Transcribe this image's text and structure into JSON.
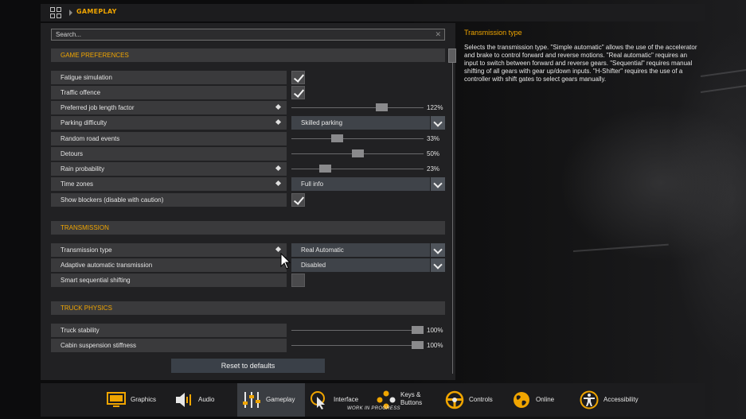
{
  "breadcrumb": {
    "label": "GAMEPLAY"
  },
  "search": {
    "placeholder": "Search..."
  },
  "sections": {
    "game_preferences": "GAME PREFERENCES",
    "transmission": "TRANSMISSION",
    "truck_physics": "TRUCK PHYSICS"
  },
  "rows": {
    "fatigue": {
      "label": "Fatigue simulation",
      "checked": true
    },
    "traffic": {
      "label": "Traffic offence",
      "checked": true
    },
    "job_length": {
      "label": "Preferred job length factor",
      "value": "122%",
      "level": 0.7
    },
    "parking": {
      "label": "Parking difficulty",
      "value": "Skilled parking"
    },
    "road_events": {
      "label": "Random road events",
      "value": "33%",
      "level": 0.33
    },
    "detours": {
      "label": "Detours",
      "value": "50%",
      "level": 0.5
    },
    "rain": {
      "label": "Rain probability",
      "value": "23%",
      "level": 0.23
    },
    "time_zones": {
      "label": "Time zones",
      "value": "Full info"
    },
    "blockers": {
      "label": "Show blockers (disable with caution)",
      "checked": true
    },
    "transmission_type": {
      "label": "Transmission type",
      "value": "Real Automatic"
    },
    "adaptive": {
      "label": "Adaptive automatic transmission",
      "value": "Disabled"
    },
    "smart_seq": {
      "label": "Smart sequential shifting",
      "checked": false
    },
    "stability": {
      "label": "Truck stability",
      "value": "100%",
      "level": 1.0
    },
    "cabin": {
      "label": "Cabin suspension stiffness",
      "value": "100%",
      "level": 1.0
    }
  },
  "reset_label": "Reset to defaults",
  "description": {
    "title": "Transmission type",
    "text": "Selects the transmission type. \"Simple automatic\" allows the use of the accelerator and brake to control forward and reverse motions. \"Real automatic\" requires an input to switch between forward and reverse gears. \"Sequential\" requires manual shifting of all gears with gear up/down inputs. \"H-Shifter\" requires the use of a controller with shift gates to select gears manually."
  },
  "nav": {
    "graphics": "Graphics",
    "audio": "Audio",
    "gameplay": "Gameplay",
    "interface": "Interface",
    "keys_line1": "Keys &",
    "keys_line2": "Buttons",
    "controls": "Controls",
    "online": "Online",
    "accessibility": "Accessibility",
    "wip": "WORK IN PROGRESS"
  },
  "colors": {
    "accent": "#f0a500",
    "panel": "#222224",
    "row": "#3a3a3c",
    "select": "#3f4349"
  }
}
